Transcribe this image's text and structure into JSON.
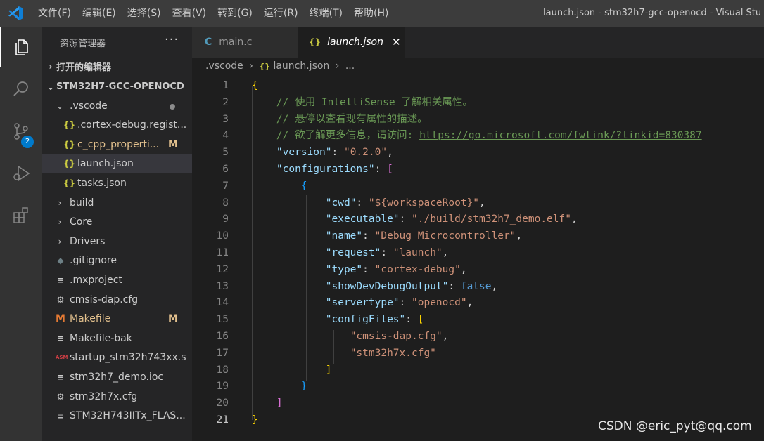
{
  "window": {
    "title": "launch.json - stm32h7-gcc-openocd - Visual Stu",
    "menu": [
      "文件(F)",
      "编辑(E)",
      "选择(S)",
      "查看(V)",
      "转到(G)",
      "运行(R)",
      "终端(T)",
      "帮助(H)"
    ]
  },
  "activity_bar": {
    "scm_badge": "2",
    "icons": [
      "explorer-icon",
      "search-icon",
      "source-control-icon",
      "run-debug-icon",
      "extensions-icon"
    ]
  },
  "explorer": {
    "title": "资源管理器",
    "more": "···",
    "open_editors": "打开的编辑器",
    "root": "STM32H7-GCC-OPENOCD",
    "items": [
      {
        "label": ".vscode",
        "type": "folder",
        "open": true,
        "status": "dot"
      },
      {
        "label": ".cortex-debug.regist...",
        "type": "json"
      },
      {
        "label": "c_cpp_properti...",
        "type": "json",
        "status": "M"
      },
      {
        "label": "launch.json",
        "type": "json",
        "selected": true
      },
      {
        "label": "tasks.json",
        "type": "json"
      },
      {
        "label": "build",
        "type": "folder"
      },
      {
        "label": "Core",
        "type": "folder"
      },
      {
        "label": "Drivers",
        "type": "folder"
      },
      {
        "label": ".gitignore",
        "type": "git"
      },
      {
        "label": ".mxproject",
        "type": "text"
      },
      {
        "label": "cmsis-dap.cfg",
        "type": "gear"
      },
      {
        "label": "Makefile",
        "type": "makefile",
        "status": "M"
      },
      {
        "label": "Makefile-bak",
        "type": "text"
      },
      {
        "label": "startup_stm32h743xx.s",
        "type": "asm"
      },
      {
        "label": "stm32h7_demo.ioc",
        "type": "text"
      },
      {
        "label": "stm32h7x.cfg",
        "type": "gear"
      },
      {
        "label": "STM32H743IITx_FLAS...",
        "type": "text"
      }
    ]
  },
  "tabs": [
    {
      "label": "main.c",
      "icon": "C"
    },
    {
      "label": "launch.json",
      "icon": "{}",
      "close": "✕"
    }
  ],
  "breadcrumb": {
    "folder": ".vscode",
    "file": "launch.json",
    "sep": "›",
    "more": "..."
  },
  "icons": {
    "folder_closed": "›",
    "folder_open": "⌄",
    "json": "{}",
    "git": "◆",
    "text": "≡",
    "gear": "⚙",
    "makefile": "M",
    "asm": "ASM",
    "c": "C"
  },
  "editor": {
    "current_line": 21,
    "lines": [
      [
        {
          "t": "{",
          "c": "b1"
        }
      ],
      [
        {
          "t": "    "
        },
        {
          "t": "// 使用 IntelliSense 了解相关属性。",
          "c": "c"
        }
      ],
      [
        {
          "t": "    "
        },
        {
          "t": "// 悬停以查看现有属性的描述。",
          "c": "c"
        }
      ],
      [
        {
          "t": "    "
        },
        {
          "t": "// 欲了解更多信息，请访问: ",
          "c": "c"
        },
        {
          "t": "https://go.microsoft.com/fwlink/?linkid=830387",
          "c": "link"
        }
      ],
      [
        {
          "t": "    "
        },
        {
          "t": "\"version\"",
          "c": "k"
        },
        {
          "t": ": ",
          "c": "p"
        },
        {
          "t": "\"0.2.0\"",
          "c": "s"
        },
        {
          "t": ",",
          "c": "p"
        }
      ],
      [
        {
          "t": "    "
        },
        {
          "t": "\"configurations\"",
          "c": "k"
        },
        {
          "t": ": ",
          "c": "p"
        },
        {
          "t": "[",
          "c": "b2"
        }
      ],
      [
        {
          "t": "        "
        },
        {
          "t": "{",
          "c": "b3"
        }
      ],
      [
        {
          "t": "            "
        },
        {
          "t": "\"cwd\"",
          "c": "k"
        },
        {
          "t": ": ",
          "c": "p"
        },
        {
          "t": "\"${workspaceRoot}\"",
          "c": "s"
        },
        {
          "t": ",",
          "c": "p"
        }
      ],
      [
        {
          "t": "            "
        },
        {
          "t": "\"executable\"",
          "c": "k"
        },
        {
          "t": ": ",
          "c": "p"
        },
        {
          "t": "\"./build/stm32h7_demo.elf\"",
          "c": "s"
        },
        {
          "t": ",",
          "c": "p"
        }
      ],
      [
        {
          "t": "            "
        },
        {
          "t": "\"name\"",
          "c": "k"
        },
        {
          "t": ": ",
          "c": "p"
        },
        {
          "t": "\"Debug Microcontroller\"",
          "c": "s"
        },
        {
          "t": ",",
          "c": "p"
        }
      ],
      [
        {
          "t": "            "
        },
        {
          "t": "\"request\"",
          "c": "k"
        },
        {
          "t": ": ",
          "c": "p"
        },
        {
          "t": "\"launch\"",
          "c": "s"
        },
        {
          "t": ",",
          "c": "p"
        }
      ],
      [
        {
          "t": "            "
        },
        {
          "t": "\"type\"",
          "c": "k"
        },
        {
          "t": ": ",
          "c": "p"
        },
        {
          "t": "\"cortex-debug\"",
          "c": "s"
        },
        {
          "t": ",",
          "c": "p"
        }
      ],
      [
        {
          "t": "            "
        },
        {
          "t": "\"showDevDebugOutput\"",
          "c": "k"
        },
        {
          "t": ": ",
          "c": "p"
        },
        {
          "t": "false",
          "c": "kw"
        },
        {
          "t": ",",
          "c": "p"
        }
      ],
      [
        {
          "t": "            "
        },
        {
          "t": "\"servertype\"",
          "c": "k"
        },
        {
          "t": ": ",
          "c": "p"
        },
        {
          "t": "\"openocd\"",
          "c": "s"
        },
        {
          "t": ",",
          "c": "p"
        }
      ],
      [
        {
          "t": "            "
        },
        {
          "t": "\"configFiles\"",
          "c": "k"
        },
        {
          "t": ": ",
          "c": "p"
        },
        {
          "t": "[",
          "c": "b1"
        }
      ],
      [
        {
          "t": "                "
        },
        {
          "t": "\"cmsis-dap.cfg\"",
          "c": "s"
        },
        {
          "t": ",",
          "c": "p"
        }
      ],
      [
        {
          "t": "                "
        },
        {
          "t": "\"stm32h7x.cfg\"",
          "c": "s"
        }
      ],
      [
        {
          "t": "            "
        },
        {
          "t": "]",
          "c": "b1"
        }
      ],
      [
        {
          "t": "        "
        },
        {
          "t": "}",
          "c": "b3"
        }
      ],
      [
        {
          "t": "    "
        },
        {
          "t": "]",
          "c": "b2"
        }
      ],
      [
        {
          "t": "}",
          "c": "b1"
        }
      ]
    ]
  },
  "watermark": "CSDN @eric_pyt@qq.com",
  "colors": {
    "accent": "#007acc",
    "json_icon": "#cbcb41",
    "modified": "#e2c08d"
  }
}
